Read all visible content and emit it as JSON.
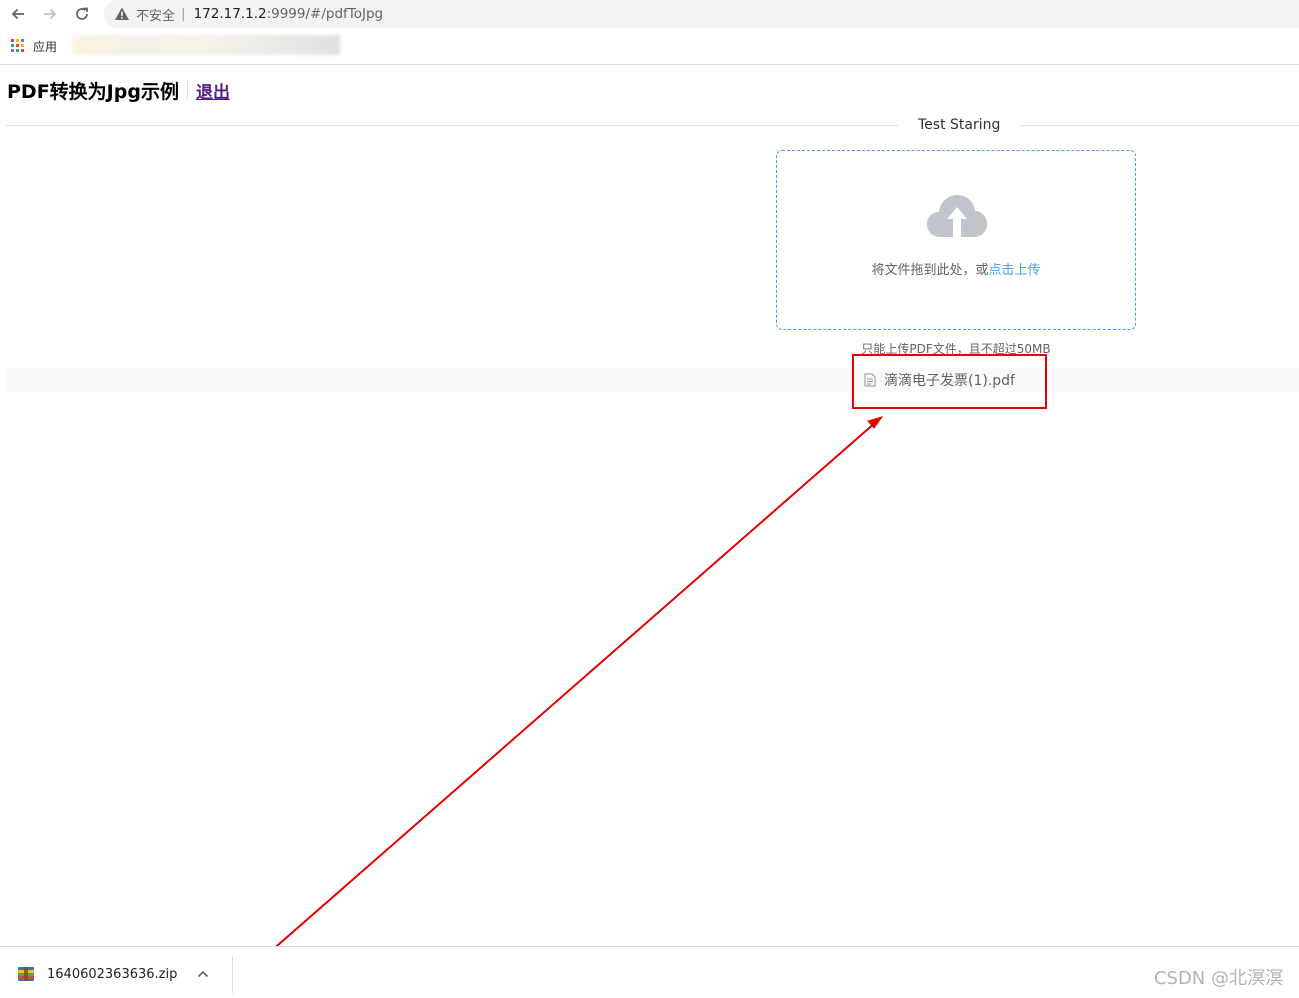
{
  "browser": {
    "security_label": "不安全",
    "url_host": "172.17.1.2",
    "url_path": ":9999/#/pdfToJpg",
    "bookmarks_label": "应用"
  },
  "page": {
    "title": "PDF转换为Jpg示例",
    "logout_link": "退出"
  },
  "divider": {
    "text": "Test Staring"
  },
  "upload": {
    "drag_text": "将文件拖到此处，或",
    "click_text": "点击上传",
    "tip": "只能上传PDF文件，且不超过50MB",
    "files": [
      {
        "name": "滴滴电子发票(1).pdf"
      }
    ]
  },
  "downloads": {
    "items": [
      {
        "name": "1640602363636.zip"
      }
    ]
  },
  "watermark": "CSDN @北溟溟",
  "colors": {
    "accent": "#409eff",
    "link_visited": "#551a8b",
    "annotation": "#e60000"
  }
}
